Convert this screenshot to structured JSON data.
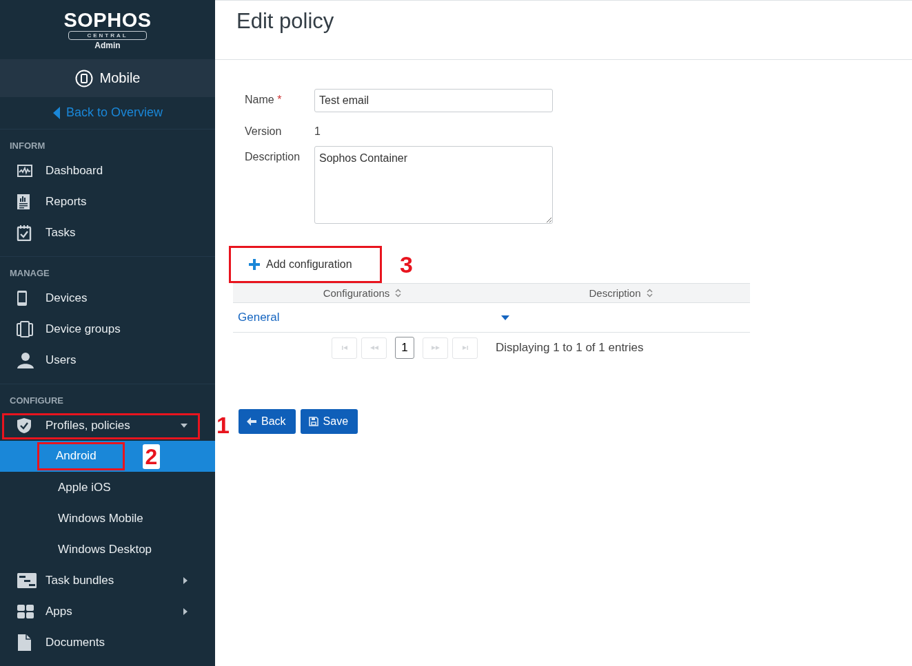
{
  "sidebar": {
    "logo": {
      "wordmark": "SOPHOS",
      "badge": "CENTRAL",
      "subtitle": "Admin"
    },
    "product": {
      "label": "Mobile"
    },
    "back_link": "Back to Overview",
    "sections": [
      {
        "heading": "INFORM",
        "items": [
          {
            "kind": "item",
            "label": "Dashboard",
            "selected": false
          },
          {
            "kind": "item",
            "label": "Reports",
            "selected": false
          },
          {
            "kind": "item",
            "label": "Tasks",
            "selected": false
          }
        ]
      },
      {
        "heading": "MANAGE",
        "items": [
          {
            "kind": "item",
            "label": "Devices",
            "selected": false
          },
          {
            "kind": "item",
            "label": "Device groups",
            "selected": false
          },
          {
            "kind": "item",
            "label": "Users",
            "selected": false
          }
        ]
      },
      {
        "heading": "CONFIGURE",
        "items": [
          {
            "kind": "item",
            "label": "Profiles, policies",
            "selected": false,
            "expanded": true,
            "callout": "1"
          },
          {
            "kind": "sub",
            "label": "Android",
            "selected": true,
            "callout": "2"
          },
          {
            "kind": "sub",
            "label": "Apple iOS",
            "selected": false
          },
          {
            "kind": "sub",
            "label": "Windows Mobile",
            "selected": false
          },
          {
            "kind": "sub",
            "label": "Windows Desktop",
            "selected": false
          },
          {
            "kind": "item",
            "label": "Task bundles",
            "selected": false,
            "expanded": false
          },
          {
            "kind": "item",
            "label": "Apps",
            "selected": false,
            "expanded": false
          },
          {
            "kind": "item",
            "label": "Documents",
            "selected": false
          }
        ]
      }
    ]
  },
  "page": {
    "title": "Edit policy",
    "form": {
      "name_label": "Name",
      "required_mark": "*",
      "name_value": "Test email",
      "version_label": "Version",
      "version_value": "1",
      "description_label": "Description",
      "description_value": "Sophos Container"
    },
    "add_button": {
      "label": "Add configuration",
      "callout": "3"
    },
    "table": {
      "columns": [
        {
          "label": "Configurations"
        },
        {
          "label": "Description"
        }
      ],
      "rows": [
        {
          "configuration": "General",
          "expanded": false
        }
      ]
    },
    "pagination": {
      "first_disabled": true,
      "prev_disabled": true,
      "page": "1",
      "next_disabled": true,
      "last_disabled": true,
      "summary": "Displaying 1 to 1 of 1 entries"
    },
    "buttons": [
      {
        "kind": "back",
        "label": "Back"
      },
      {
        "kind": "save",
        "label": "Save"
      }
    ]
  }
}
